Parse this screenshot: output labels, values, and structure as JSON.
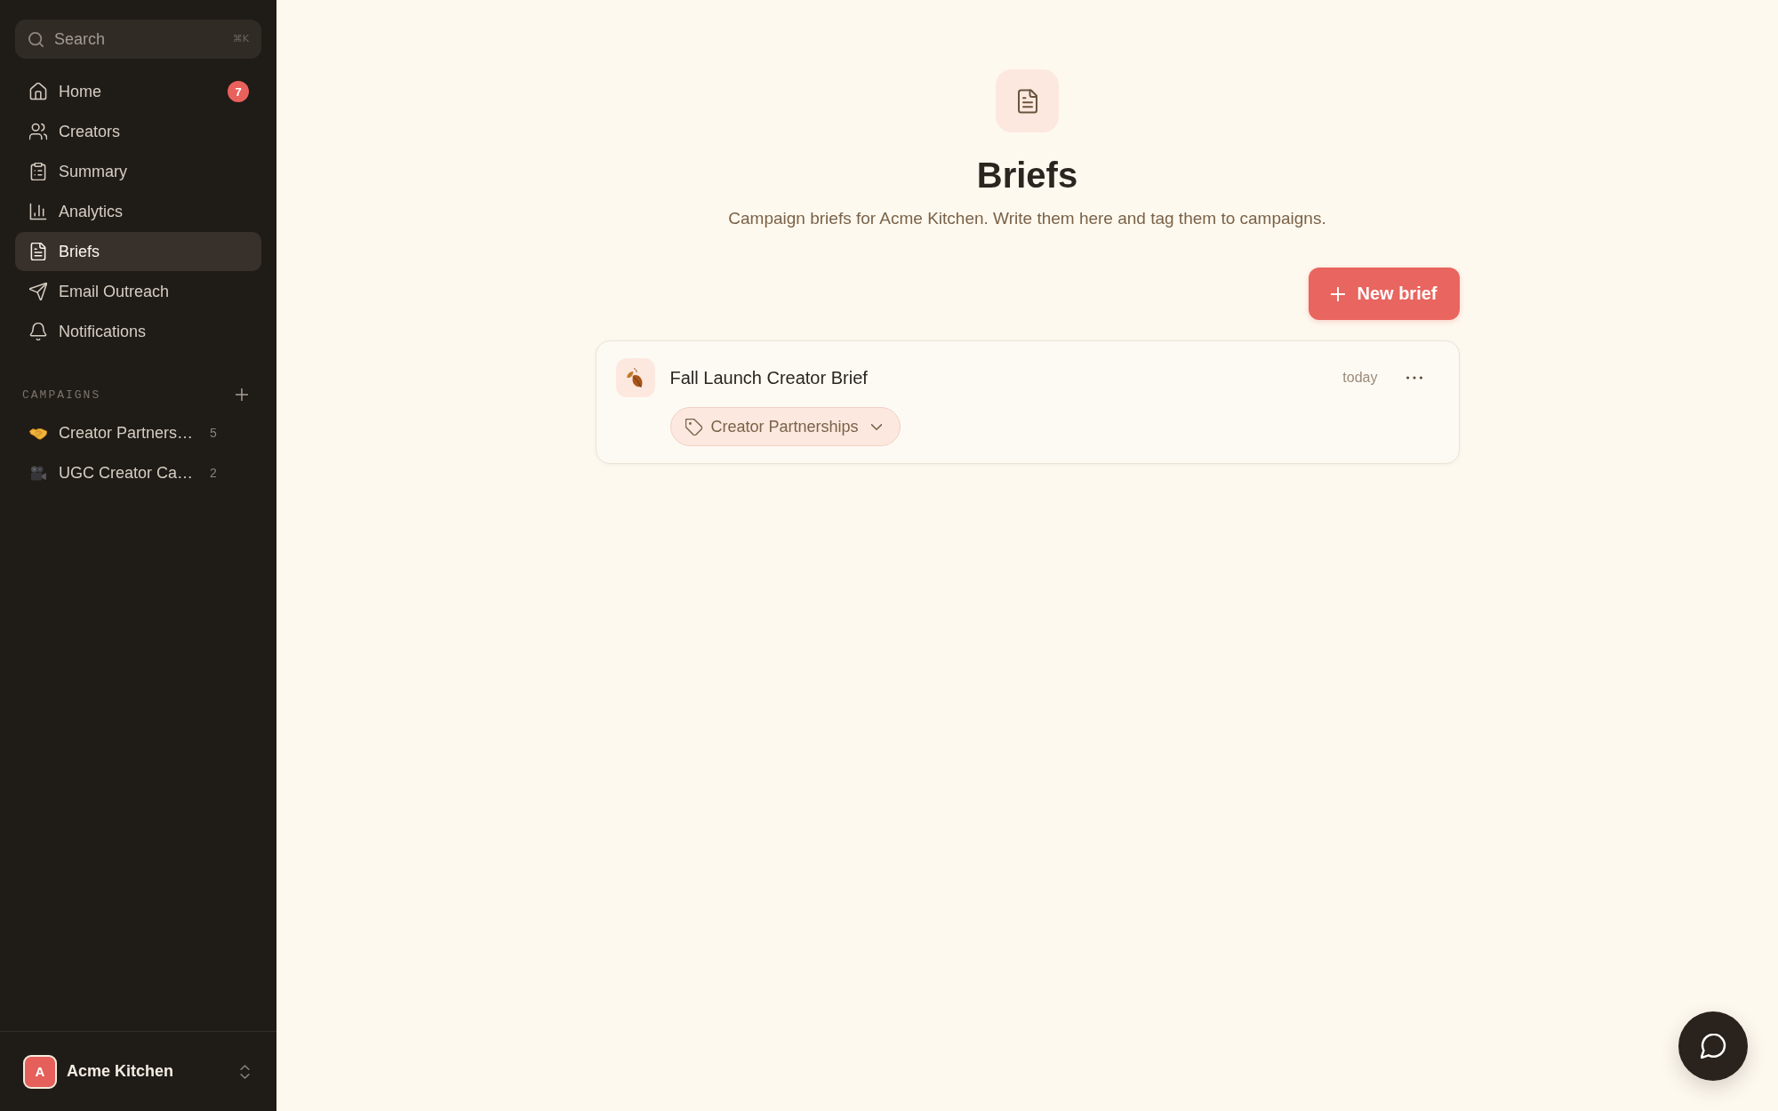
{
  "sidebar": {
    "search": {
      "placeholder": "Search",
      "shortcut": "⌘K"
    },
    "nav_items": [
      {
        "label": "Home",
        "badge": "7",
        "selected": false
      },
      {
        "label": "Creators",
        "selected": false
      },
      {
        "label": "Summary",
        "selected": false
      },
      {
        "label": "Analytics",
        "selected": false
      },
      {
        "label": "Briefs",
        "selected": true
      },
      {
        "label": "Email Outreach",
        "selected": false
      },
      {
        "label": "Notifications",
        "selected": false
      }
    ],
    "campaigns": {
      "heading": "CAMPAIGNS",
      "items": [
        {
          "name": "Creator Partners…",
          "count": "5"
        },
        {
          "name": "UGC Creator Ca…",
          "count": "2"
        }
      ]
    },
    "workspace": {
      "initial": "A",
      "name": "Acme Kitchen"
    }
  },
  "main": {
    "title": "Briefs",
    "subtitle": "Campaign briefs for Acme Kitchen. Write them here and tag them to campaigns.",
    "new_button": "New brief",
    "briefs": [
      {
        "title": "Fall Launch Creator Brief",
        "date": "today",
        "campaign": "Creator Partnerships"
      }
    ]
  }
}
